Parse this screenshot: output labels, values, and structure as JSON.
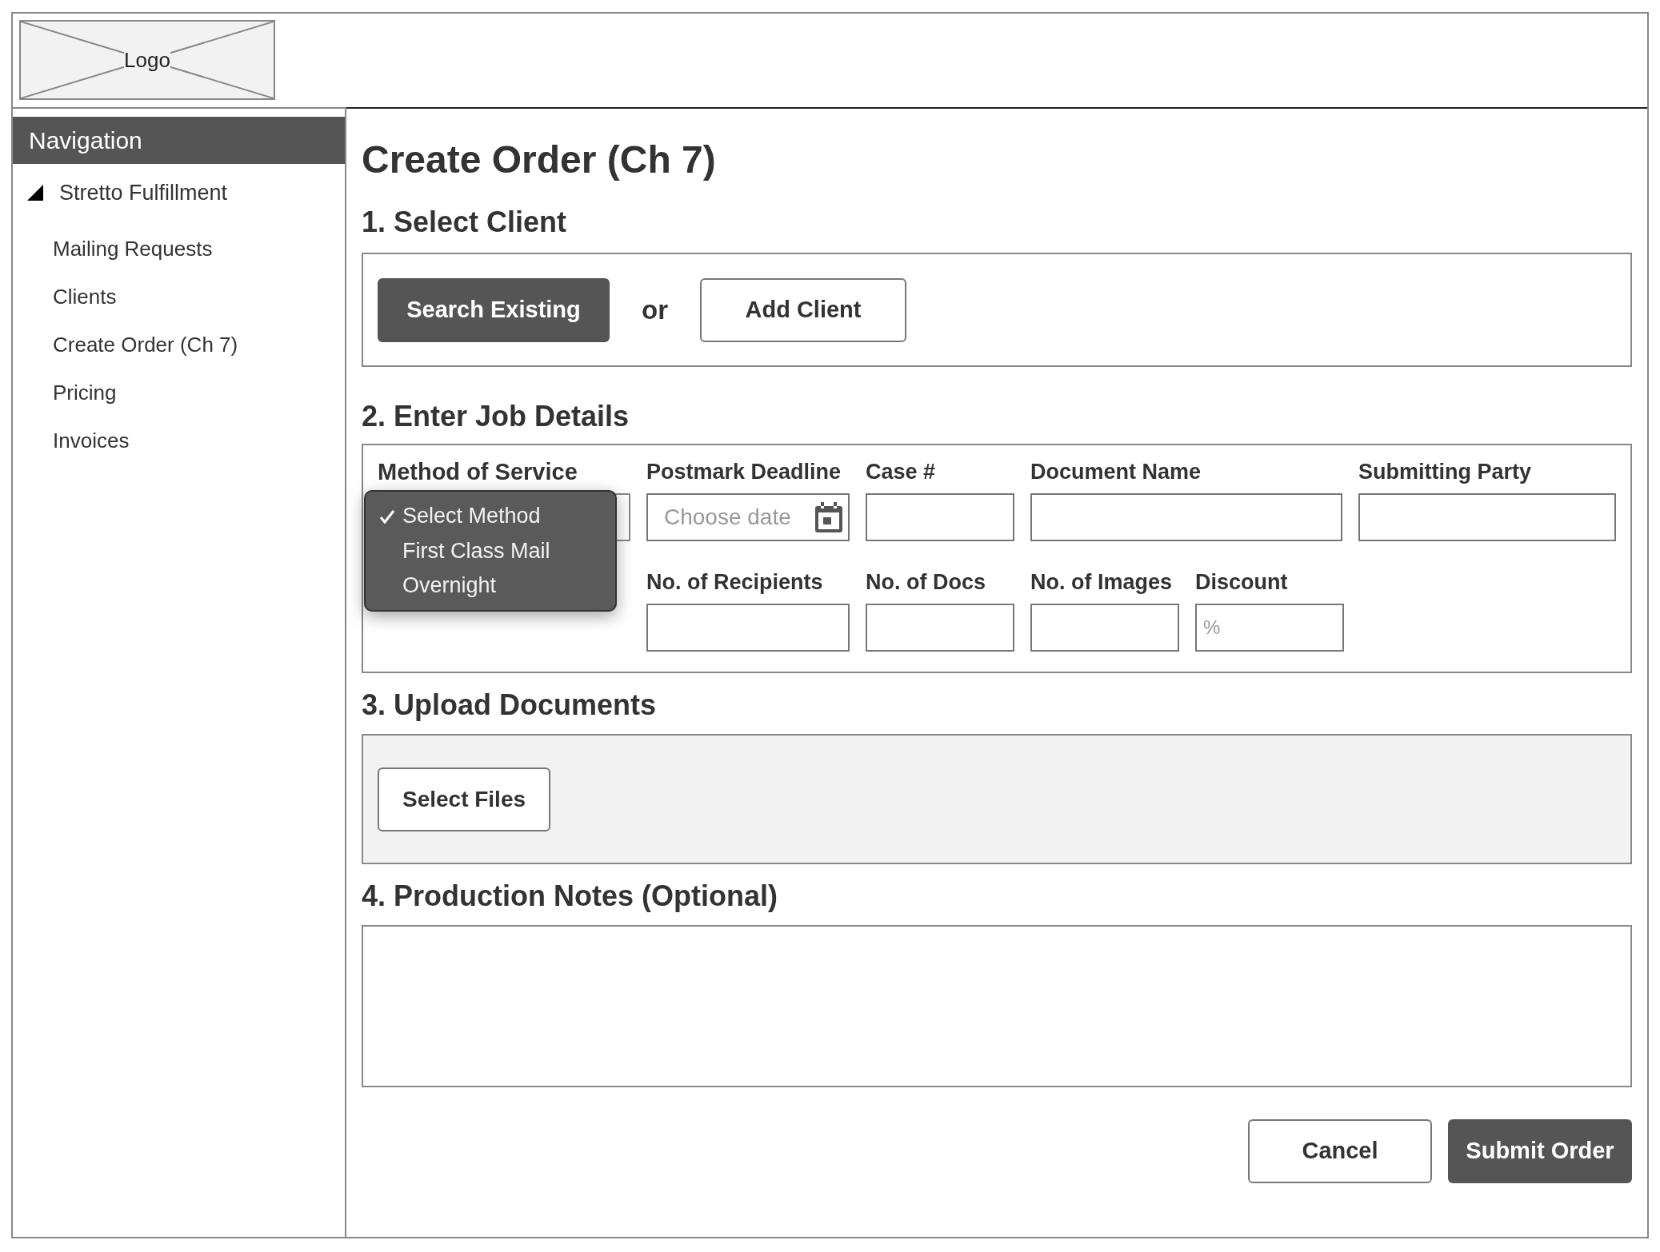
{
  "logo": {
    "label": "Logo"
  },
  "sidebar": {
    "title": "Navigation",
    "group": {
      "label": "Stretto Fulfillment",
      "expanded": true,
      "children": [
        {
          "label": "Mailing Requests"
        },
        {
          "label": "Clients"
        },
        {
          "label": "Create Order (Ch 7)"
        },
        {
          "label": "Pricing"
        },
        {
          "label": "Invoices"
        }
      ]
    }
  },
  "title": "Create Order (Ch 7)",
  "section_1": {
    "heading": "1. Select Client",
    "primary_button": "Search Existing",
    "separator": "or",
    "secondary_button": "Add Client"
  },
  "section_2": {
    "heading": "2. Enter Job Details",
    "method": {
      "label": "Method of Service",
      "options": [
        {
          "label": "Select Method",
          "selected": true
        },
        {
          "label": "First Class Mail",
          "selected": false
        },
        {
          "label": "Overnight",
          "selected": false
        }
      ]
    },
    "postmark": {
      "label": "Postmark Deadline",
      "placeholder": "Choose date"
    },
    "case": {
      "label": "Case #"
    },
    "document_name": {
      "label": "Document Name"
    },
    "submitting_party": {
      "label": "Submitting Party"
    },
    "recipients": {
      "label": "No. of Recipients"
    },
    "docs": {
      "label": "No. of Docs"
    },
    "images": {
      "label": "No. of Images"
    },
    "discount": {
      "label": "Discount",
      "placeholder": "%"
    }
  },
  "section_3": {
    "heading": "3. Upload Documents",
    "button": "Select Files"
  },
  "section_4": {
    "heading": "4. Production Notes (Optional)"
  },
  "buttons": {
    "cancel": "Cancel",
    "submit": "Submit Order"
  }
}
